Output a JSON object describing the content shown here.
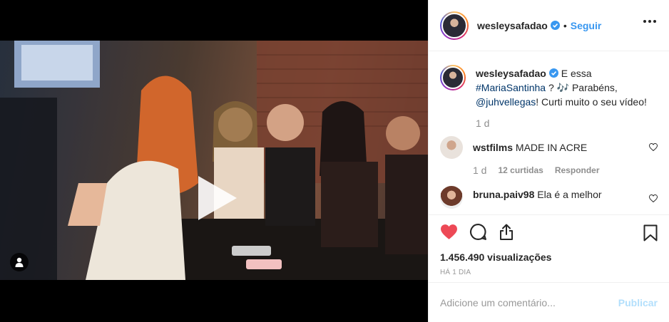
{
  "post": {
    "author": "wesleysafadao",
    "follow_label": "Seguir",
    "separator": "•",
    "caption": {
      "text_before": "E essa",
      "hashtag": "#MariaSantinha",
      "text_mid": "? 🎶 Parabéns,",
      "mention": "@juhvellegas",
      "text_after": "! Curti muito o seu vídeo!"
    },
    "caption_age": "1 d"
  },
  "comments": [
    {
      "user": "wstfilms",
      "text": "MADE IN ACRE",
      "age": "1 d",
      "likes": "12 curtidas",
      "reply_label": "Responder"
    },
    {
      "user": "bruna.paiv98",
      "text": "Ela é a melhor"
    }
  ],
  "stats": {
    "views": "1.456.490 visualizações",
    "posted": "HÁ 1 DIA"
  },
  "comment_box": {
    "placeholder": "Adicione um comentário...",
    "publish_label": "Publicar"
  },
  "colors": {
    "like_red": "#ed4956",
    "link_blue": "#3897f0",
    "verified_blue": "#3897f0",
    "publish_disabled": "#b2dffc"
  },
  "icons": [
    "play-icon",
    "user-tag-icon",
    "more-options-icon",
    "verified-icon",
    "heart-icon",
    "comment-icon",
    "share-icon",
    "bookmark-icon"
  ]
}
